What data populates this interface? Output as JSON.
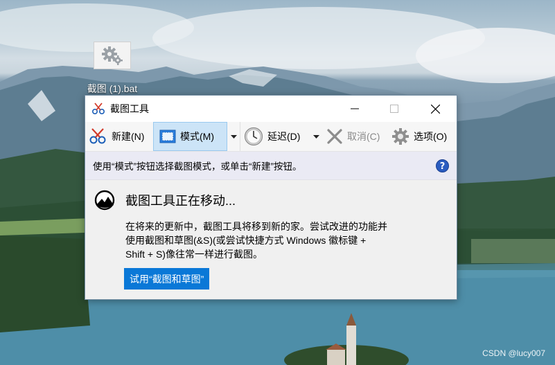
{
  "desktop": {
    "icon_label": "截图 (1).bat",
    "watermark": "CSDN @lucy007"
  },
  "window": {
    "title": "截图工具",
    "controls": {
      "minimize": "minimize",
      "maximize": "maximize",
      "close": "close"
    }
  },
  "toolbar": {
    "new_label": "新建(N)",
    "mode_label": "模式(M)",
    "delay_label": "延迟(D)",
    "cancel_label": "取消(C)",
    "options_label": "选项(O)"
  },
  "hint": {
    "text": "使用“模式”按钮选择截图模式，或单击“新建”按钮。"
  },
  "notice": {
    "title": "截图工具正在移动...",
    "body_line1": "在将来的更新中，截图工具将移到新的家。尝试改进的功能并",
    "body_line2": "使用截图和草图(&S)(或尝试快捷方式 Windows 徽标键 +",
    "body_line3": "Shift + S)像往常一样进行截图。",
    "button_label": "试用“截图和草图”"
  },
  "colors": {
    "accent": "#0a78d7",
    "mode_active_bg": "#cce4f7",
    "hint_bg": "#eaeaf4",
    "window_bg": "#f0f0f0"
  },
  "icons": [
    "gear-icon",
    "scissors-icon",
    "rectangle-select-icon",
    "clock-icon",
    "x-icon",
    "settings-gear-icon",
    "help-icon",
    "snip-sketch-icon",
    "chevron-down-icon"
  ]
}
